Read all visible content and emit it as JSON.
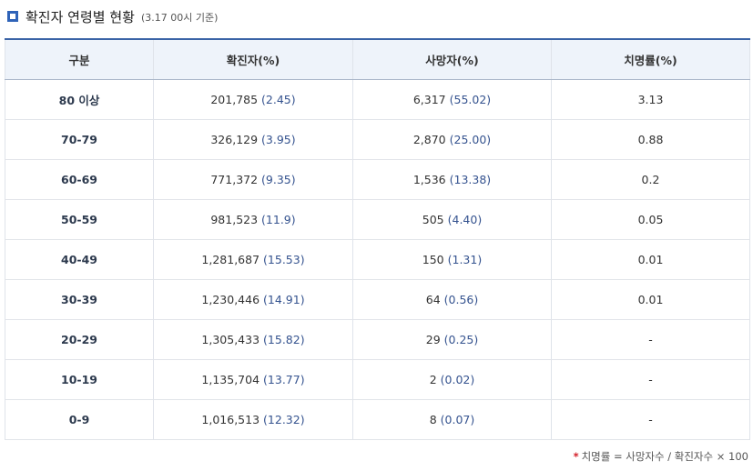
{
  "header": {
    "title": "확진자 연령별 현황",
    "subtitle": "(3.17 00시 기준)"
  },
  "table": {
    "columns": [
      "구분",
      "확진자(%)",
      "사망자(%)",
      "치명률(%)"
    ],
    "rows": [
      {
        "age": "80 이상",
        "cases": "201,785",
        "cases_pct": "(2.45)",
        "deaths": "6,317",
        "deaths_pct": "(55.02)",
        "fatality": "3.13"
      },
      {
        "age": "70-79",
        "cases": "326,129",
        "cases_pct": "(3.95)",
        "deaths": "2,870",
        "deaths_pct": "(25.00)",
        "fatality": "0.88"
      },
      {
        "age": "60-69",
        "cases": "771,372",
        "cases_pct": "(9.35)",
        "deaths": "1,536",
        "deaths_pct": "(13.38)",
        "fatality": "0.2"
      },
      {
        "age": "50-59",
        "cases": "981,523",
        "cases_pct": "(11.9)",
        "deaths": "505",
        "deaths_pct": "(4.40)",
        "fatality": "0.05"
      },
      {
        "age": "40-49",
        "cases": "1,281,687",
        "cases_pct": "(15.53)",
        "deaths": "150",
        "deaths_pct": "(1.31)",
        "fatality": "0.01"
      },
      {
        "age": "30-39",
        "cases": "1,230,446",
        "cases_pct": "(14.91)",
        "deaths": "64",
        "deaths_pct": "(0.56)",
        "fatality": "0.01"
      },
      {
        "age": "20-29",
        "cases": "1,305,433",
        "cases_pct": "(15.82)",
        "deaths": "29",
        "deaths_pct": "(0.25)",
        "fatality": "-"
      },
      {
        "age": "10-19",
        "cases": "1,135,704",
        "cases_pct": "(13.77)",
        "deaths": "2",
        "deaths_pct": "(0.02)",
        "fatality": "-"
      },
      {
        "age": "0-9",
        "cases": "1,016,513",
        "cases_pct": "(12.32)",
        "deaths": "8",
        "deaths_pct": "(0.07)",
        "fatality": "-"
      }
    ]
  },
  "footnote": {
    "mark": "*",
    "text": "치명률 = 사망자수 / 확진자수 × 100"
  },
  "colors": {
    "accent": "#2f63b8",
    "header_bg": "#eef3fa",
    "value_blue": "#35538f",
    "footnote_mark": "#d4202a"
  }
}
